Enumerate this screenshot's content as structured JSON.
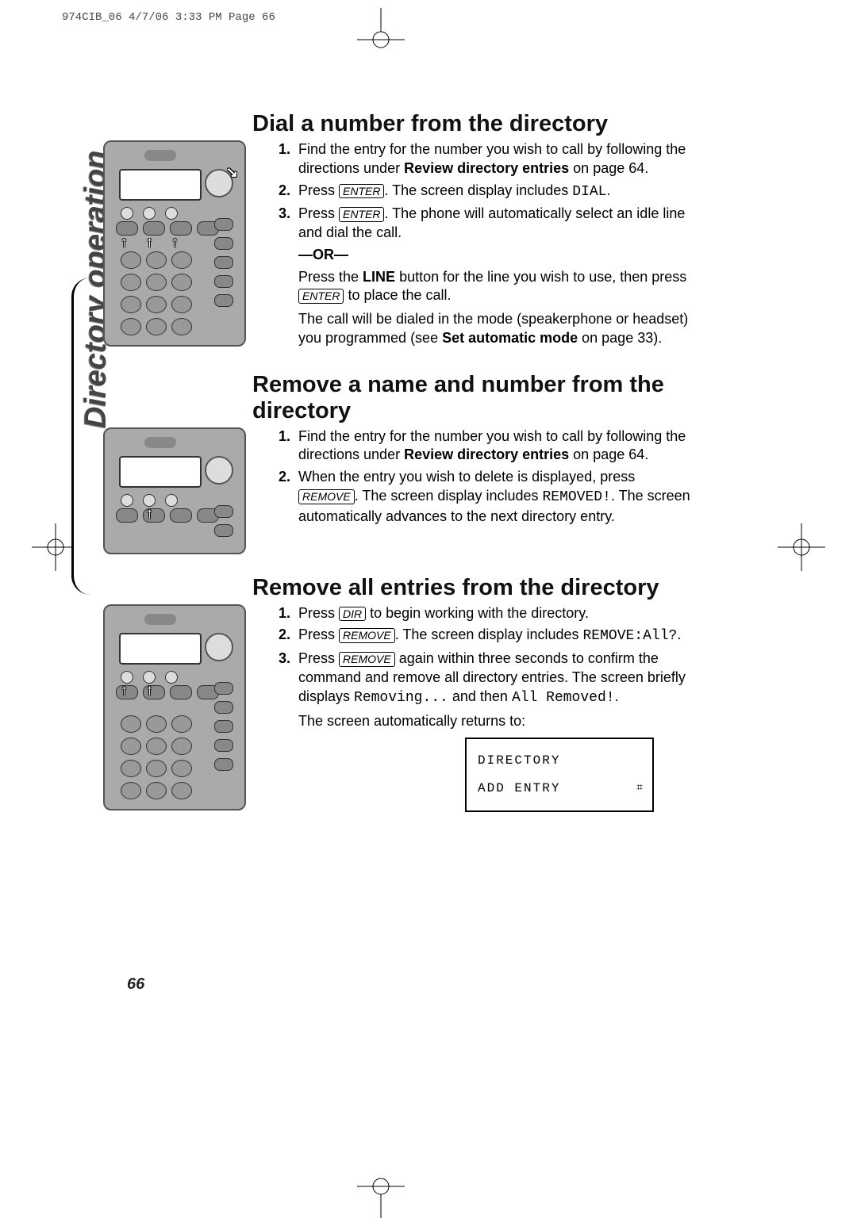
{
  "doc_header": "974CIB_06  4/7/06  3:33 PM  Page 66",
  "sidebar_label": "Directory operation",
  "buttons": {
    "enter": "ENTER",
    "remove": "REMOVE",
    "dir": "DIR"
  },
  "screen_literals": {
    "dial": "DIAL",
    "removed": "REMOVED!",
    "remove_all_q": "REMOVE:All?",
    "removing": "Removing...",
    "all_removed": "All Removed!"
  },
  "lcd": {
    "line1": "DIRECTORY",
    "line2": "ADD ENTRY"
  },
  "sections": {
    "s1": {
      "title": "Dial a number from the directory",
      "steps": {
        "n1": "1.",
        "t1a": "Find the entry for the number you wish to call by following the directions under ",
        "t1b": "Review directory entries",
        "t1c": " on page 64.",
        "n2": "2.",
        "t2a": "Press ",
        "t2b": ". The screen display includes ",
        "t2c": ".",
        "n3": "3.",
        "t3a": "Press ",
        "t3b": ". The phone will automatically select an idle line and dial the call.",
        "or": "—OR—",
        "t3c": "Press the ",
        "t3d": "LINE",
        "t3e": " button for the line you wish to use, then press ",
        "t3f": " to place the call.",
        "t3g": "The call will be dialed in the mode (speakerphone or headset) you programmed (see ",
        "t3h": "Set automatic mode",
        "t3i": " on page 33)."
      }
    },
    "s2": {
      "title": "Remove a name and number from the directory",
      "steps": {
        "n1": "1.",
        "t1a": "Find the entry for the number you wish to call by following the directions under ",
        "t1b": "Review directory entries",
        "t1c": " on page 64.",
        "n2": "2.",
        "t2a": "When the entry you wish to delete is displayed, press ",
        "t2b": ". The screen display includes ",
        "t2c": ". The screen automatically advances to the next directory entry."
      }
    },
    "s3": {
      "title": "Remove all entries from the directory",
      "steps": {
        "n1": "1.",
        "t1a": "Press ",
        "t1b": " to begin working with the directory.",
        "n2": "2.",
        "t2a": "Press ",
        "t2b": ". The screen display includes ",
        "t2c": ".",
        "n3": "3.",
        "t3a": "Press ",
        "t3b": " again within three seconds to confirm the command and remove all directory entries. The screen briefly displays ",
        "t3c": " and then ",
        "t3d": ".",
        "t3e": "The screen automatically returns to:"
      }
    }
  },
  "page_number": "66"
}
